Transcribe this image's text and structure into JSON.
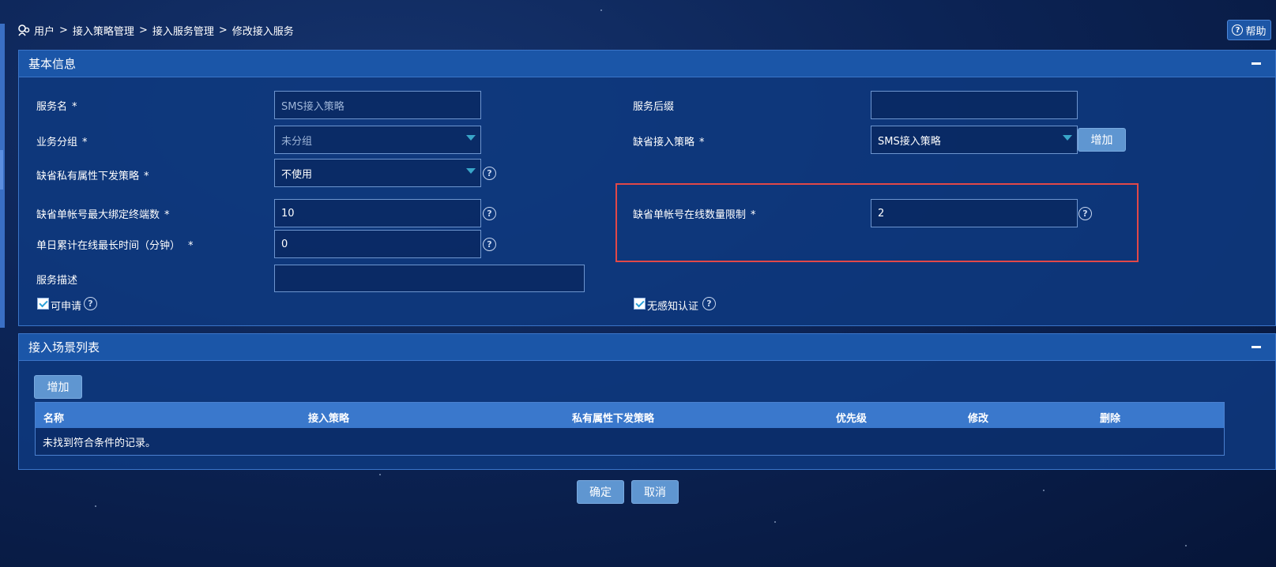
{
  "breadcrumb": {
    "items": [
      "用户",
      "接入策略管理",
      "接入服务管理",
      "修改接入服务"
    ],
    "separator": ">"
  },
  "help_button": {
    "label": "帮助"
  },
  "basic_info": {
    "title": "基本信息",
    "service_name": {
      "label": "服务名",
      "required": "*",
      "value": "SMS接入策略"
    },
    "service_suffix": {
      "label": "服务后缀",
      "value": ""
    },
    "business_group": {
      "label": "业务分组",
      "required": "*",
      "value": "未分组"
    },
    "default_access_policy": {
      "label": "缺省接入策略",
      "required": "*",
      "value": "SMS接入策略"
    },
    "add_button": "增加",
    "default_private_policy": {
      "label": "缺省私有属性下发策略",
      "required": "*",
      "value": "不使用"
    },
    "max_bind_terminals": {
      "label": "缺省单帐号最大绑定终端数",
      "required": "*",
      "value": "10"
    },
    "online_limit": {
      "label": "缺省单帐号在线数量限制",
      "required": "*",
      "value": "2"
    },
    "daily_online_time": {
      "label": "单日累计在线最长时间（分钟）",
      "required": "*",
      "value": "0"
    },
    "service_desc": {
      "label": "服务描述",
      "value": ""
    },
    "applicable": {
      "label": "可申请",
      "checked": true
    },
    "seamless_auth": {
      "label": "无感知认证",
      "checked": true
    }
  },
  "scenario_list": {
    "title": "接入场景列表",
    "add_button": "增加",
    "columns": [
      "名称",
      "接入策略",
      "私有属性下发策略",
      "优先级",
      "修改",
      "删除"
    ],
    "empty_text": "未找到符合条件的记录。"
  },
  "footer": {
    "confirm": "确定",
    "cancel": "取消"
  },
  "colors": {
    "panel_header": "#1b56a8",
    "table_header": "#3a78cc",
    "button": "#5f96d1",
    "highlight_box": "#e14848"
  }
}
